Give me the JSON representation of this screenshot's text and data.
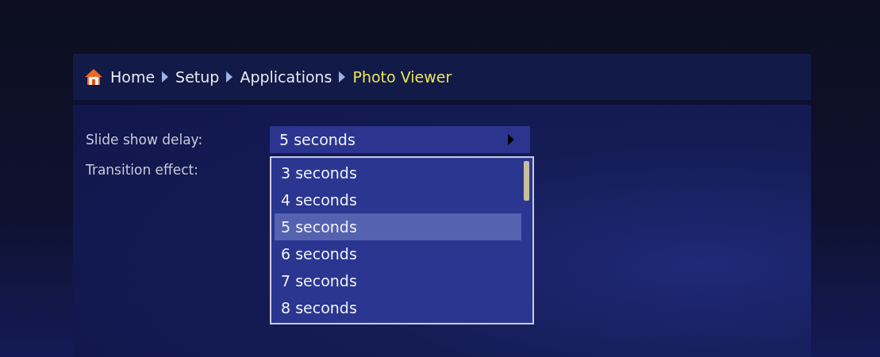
{
  "breadcrumb": [
    {
      "label": "Home",
      "current": false
    },
    {
      "label": "Setup",
      "current": false
    },
    {
      "label": "Applications",
      "current": false
    },
    {
      "label": "Photo Viewer",
      "current": true
    }
  ],
  "settings": [
    {
      "label": "Slide show delay:",
      "value": "5 seconds",
      "expanded": true
    },
    {
      "label": "Transition effect:"
    }
  ],
  "dropdown": [
    {
      "label": "3 seconds",
      "selected": false
    },
    {
      "label": "4 seconds",
      "selected": false
    },
    {
      "label": "5 seconds",
      "selected": true
    },
    {
      "label": "6 seconds",
      "selected": false
    },
    {
      "label": "7 seconds",
      "selected": false
    },
    {
      "label": "8 seconds",
      "selected": false
    }
  ]
}
